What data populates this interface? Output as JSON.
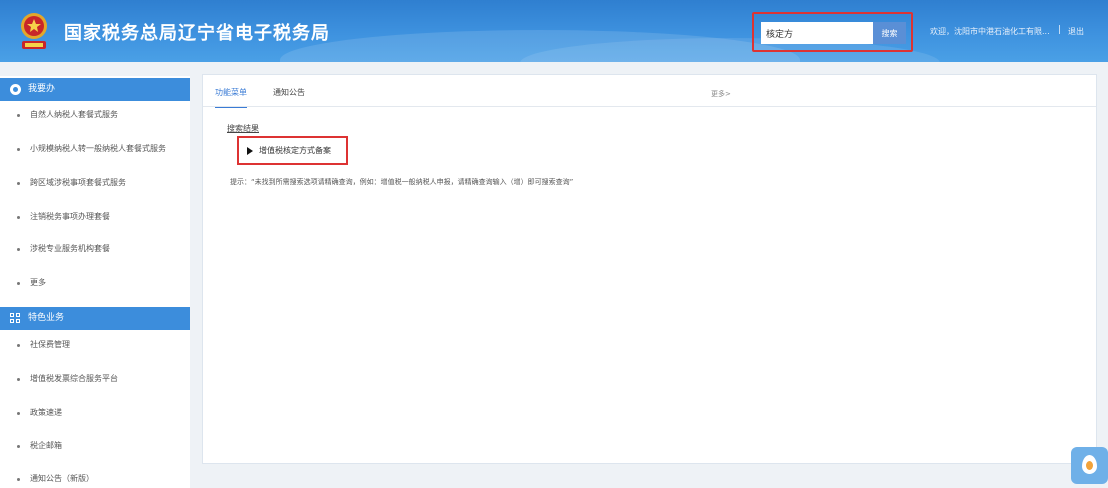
{
  "header": {
    "title": "国家税务总局辽宁省电子税务局",
    "search_value": "核定方",
    "search_button": "搜索",
    "welcome": "欢迎，沈阳市中港石油化工有限...",
    "separator": "|",
    "logout": "退出"
  },
  "sidebar": {
    "section1": {
      "title": "我要办",
      "items": [
        "自然人纳税人套餐式服务",
        "小规模纳税人转一般纳税人套餐式服务",
        "跨区域涉税事项套餐式服务",
        "注销税务事项办理套餐",
        "涉税专业服务机构套餐",
        "更多"
      ]
    },
    "section2": {
      "title": "特色业务",
      "items": [
        "社保费管理",
        "增值税发票综合服务平台",
        "政策速递",
        "税企邮箱",
        "通知公告（新版）"
      ]
    }
  },
  "main": {
    "tabs": [
      "功能菜单",
      "通知公告"
    ],
    "more": "更多>",
    "result_heading": "搜索结果",
    "result_link": "增值税核定方式备案",
    "tip": "提示：“未找到所需搜索选项请精确查询，例如：增值税一般纳税人申报，请精确查询输入（增）即可搜索查询”"
  },
  "colors": {
    "header_blue": "#3e92df",
    "sidebar_head": "#3c8ddc",
    "highlight_red": "#d33",
    "tab_active": "#3a7bd5"
  }
}
